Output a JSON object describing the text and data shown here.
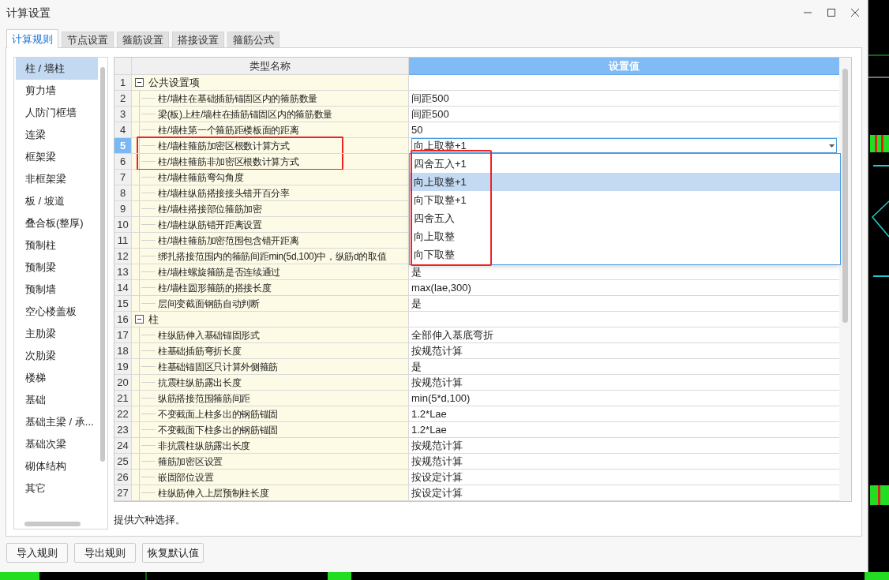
{
  "window": {
    "title": "计算设置"
  },
  "tabs": [
    {
      "label": "计算规则",
      "selected": true
    },
    {
      "label": "节点设置",
      "selected": false
    },
    {
      "label": "箍筋设置",
      "selected": false
    },
    {
      "label": "搭接设置",
      "selected": false
    },
    {
      "label": "箍筋公式",
      "selected": false
    }
  ],
  "sidebar": {
    "items": [
      {
        "label": "柱 / 墙柱",
        "selected": true
      },
      {
        "label": "剪力墙",
        "selected": false
      },
      {
        "label": "人防门框墙",
        "selected": false
      },
      {
        "label": "连梁",
        "selected": false
      },
      {
        "label": "框架梁",
        "selected": false
      },
      {
        "label": "非框架梁",
        "selected": false
      },
      {
        "label": "板 / 坡道",
        "selected": false
      },
      {
        "label": "叠合板(整厚)",
        "selected": false
      },
      {
        "label": "预制柱",
        "selected": false
      },
      {
        "label": "预制梁",
        "selected": false
      },
      {
        "label": "预制墙",
        "selected": false
      },
      {
        "label": "空心楼盖板",
        "selected": false
      },
      {
        "label": "主肋梁",
        "selected": false
      },
      {
        "label": "次肋梁",
        "selected": false
      },
      {
        "label": "楼梯",
        "selected": false
      },
      {
        "label": "基础",
        "selected": false
      },
      {
        "label": "基础主梁 / 承...",
        "selected": false
      },
      {
        "label": "基础次梁",
        "selected": false
      },
      {
        "label": "砌体结构",
        "selected": false
      },
      {
        "label": "其它",
        "selected": false
      }
    ]
  },
  "table": {
    "columns": [
      "类型名称",
      "设置值"
    ],
    "rows": [
      {
        "number": "1",
        "kind": "group",
        "name": "公共设置项",
        "expanded": true,
        "selected": false,
        "highlighted": false
      },
      {
        "number": "2",
        "kind": "item",
        "name": "柱/墙柱在基础插筋锚固区内的箍筋数量",
        "value": "间距500",
        "selected": false,
        "highlighted": false
      },
      {
        "number": "3",
        "kind": "item",
        "name": "梁(板)上柱/墙柱在插筋锚固区内的箍筋数量",
        "value": "间距500",
        "selected": false,
        "highlighted": false
      },
      {
        "number": "4",
        "kind": "item",
        "name": "柱/墙柱第一个箍筋距楼板面的距离",
        "value": "50",
        "selected": false,
        "highlighted": false
      },
      {
        "number": "5",
        "kind": "item",
        "name": "柱/墙柱箍筋加密区根数计算方式",
        "value": "向上取整+1",
        "selected": true,
        "highlighted": true
      },
      {
        "number": "6",
        "kind": "item",
        "name": "柱/墙柱箍筋非加密区根数计算方式",
        "selected": false,
        "highlighted": true
      },
      {
        "number": "7",
        "kind": "item",
        "name": "柱/墙柱箍筋弯勾角度",
        "selected": false,
        "highlighted": false
      },
      {
        "number": "8",
        "kind": "item",
        "name": "柱/墙柱纵筋搭接接头错开百分率",
        "selected": false,
        "highlighted": false
      },
      {
        "number": "9",
        "kind": "item",
        "name": "柱/墙柱搭接部位箍筋加密",
        "selected": false,
        "highlighted": false
      },
      {
        "number": "10",
        "kind": "item",
        "name": "柱/墙柱纵筋错开距离设置",
        "selected": false,
        "highlighted": false
      },
      {
        "number": "11",
        "kind": "item",
        "name": "柱/墙柱箍筋加密范围包含错开距离",
        "selected": false,
        "highlighted": false
      },
      {
        "number": "12",
        "kind": "item",
        "name": "绑扎搭接范围内的箍筋间距min(5d,100)中，纵筋d的取值",
        "selected": false,
        "highlighted": false
      },
      {
        "number": "13",
        "kind": "item",
        "name": "柱/墙柱螺旋箍筋是否连续通过",
        "value": "是",
        "selected": false,
        "highlighted": false
      },
      {
        "number": "14",
        "kind": "item",
        "name": "柱/墙柱圆形箍筋的搭接长度",
        "value": "max(lae,300)",
        "selected": false,
        "highlighted": false
      },
      {
        "number": "15",
        "kind": "item",
        "name": "层间变截面钢筋自动判断",
        "value": "是",
        "selected": false,
        "highlighted": false
      },
      {
        "number": "16",
        "kind": "group",
        "name": "柱",
        "expanded": true,
        "selected": false,
        "highlighted": false
      },
      {
        "number": "17",
        "kind": "item",
        "name": "柱纵筋伸入基础锚固形式",
        "value": "全部伸入基底弯折",
        "selected": false,
        "highlighted": false
      },
      {
        "number": "18",
        "kind": "item",
        "name": "柱基础插筋弯折长度",
        "value": "按规范计算",
        "selected": false,
        "highlighted": false
      },
      {
        "number": "19",
        "kind": "item",
        "name": "柱基础锚固区只计算外侧箍筋",
        "value": "是",
        "selected": false,
        "highlighted": false
      },
      {
        "number": "20",
        "kind": "item",
        "name": "抗震柱纵筋露出长度",
        "value": "按规范计算",
        "selected": false,
        "highlighted": false
      },
      {
        "number": "21",
        "kind": "item",
        "name": "纵筋搭接范围箍筋间距",
        "value": "min(5*d,100)",
        "selected": false,
        "highlighted": false
      },
      {
        "number": "22",
        "kind": "item",
        "name": "不变截面上柱多出的钢筋锚固",
        "value": "1.2*Lae",
        "selected": false,
        "highlighted": false
      },
      {
        "number": "23",
        "kind": "item",
        "name": "不变截面下柱多出的钢筋锚固",
        "value": "1.2*Lae",
        "selected": false,
        "highlighted": false
      },
      {
        "number": "24",
        "kind": "item",
        "name": "非抗震柱纵筋露出长度",
        "value": "按规范计算",
        "selected": false,
        "highlighted": false
      },
      {
        "number": "25",
        "kind": "item",
        "name": "箍筋加密区设置",
        "value": "按规范计算",
        "selected": false,
        "highlighted": false
      },
      {
        "number": "26",
        "kind": "item",
        "name": "嵌固部位设置",
        "value": "按设定计算",
        "selected": false,
        "highlighted": false
      },
      {
        "number": "27",
        "kind": "item",
        "name": "柱纵筋伸入上层预制柱长度",
        "value": "按设定计算",
        "selected": false,
        "highlighted": false
      }
    ],
    "dropdown": {
      "highlighted": true,
      "options": [
        {
          "label": "四舍五入+1",
          "selected": false
        },
        {
          "label": "向上取整+1",
          "selected": true
        },
        {
          "label": "向下取整+1",
          "selected": false
        },
        {
          "label": "四舍五入",
          "selected": false
        },
        {
          "label": "向上取整",
          "selected": false
        },
        {
          "label": "向下取整",
          "selected": false
        }
      ]
    }
  },
  "status_text": "提供六种选择。",
  "buttons": [
    "导入规则",
    "导出规则",
    "恢复默认值"
  ]
}
